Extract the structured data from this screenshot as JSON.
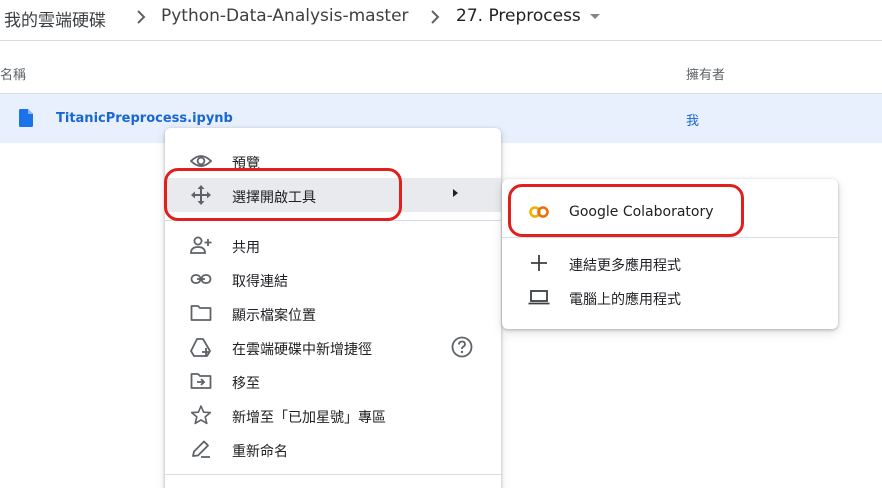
{
  "breadcrumb": {
    "items": [
      "我的雲端硬碟",
      "Python-Data-Analysis-master",
      "27. Preprocess"
    ]
  },
  "table": {
    "columns": {
      "name": "名稱",
      "owner": "擁有者"
    },
    "rows": [
      {
        "name": "TitanicPreprocess.ipynb",
        "owner": "我"
      }
    ]
  },
  "context_menu": {
    "items": [
      {
        "label": "預覽",
        "icon": "eye-icon"
      },
      {
        "label": "選擇開啟工具",
        "icon": "open-with-icon",
        "has_submenu": true
      },
      {
        "label": "共用",
        "icon": "person-add-icon"
      },
      {
        "label": "取得連結",
        "icon": "link-icon"
      },
      {
        "label": "顯示檔案位置",
        "icon": "folder-icon"
      },
      {
        "label": "在雲端硬碟中新增捷徑",
        "icon": "add-shortcut-icon",
        "has_help": true
      },
      {
        "label": "移至",
        "icon": "move-to-icon"
      },
      {
        "label": "新增至「已加星號」專區",
        "icon": "star-icon"
      },
      {
        "label": "重新命名",
        "icon": "pencil-icon"
      }
    ]
  },
  "submenu": {
    "items": [
      {
        "label": "Google Colaboratory",
        "icon": "colab-logo-icon"
      },
      {
        "label": "連結更多應用程式",
        "icon": "plus-icon"
      },
      {
        "label": "電腦上的應用程式",
        "icon": "laptop-icon"
      }
    ]
  },
  "colors": {
    "selection": "#e8f0fe",
    "link_blue": "#1967d2",
    "annotation_red": "#e0201d",
    "colab_orange": "#f9ab00"
  }
}
